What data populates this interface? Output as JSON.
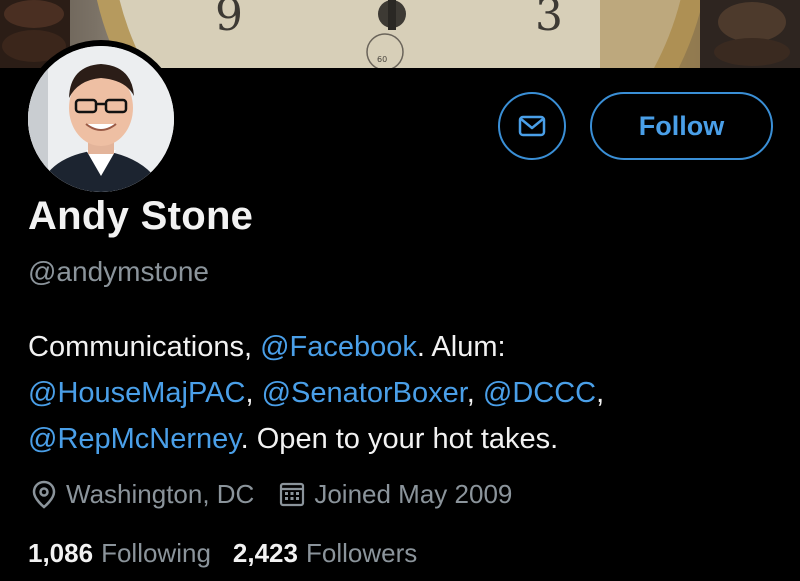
{
  "banner": {},
  "profile": {
    "name": "Andy Stone",
    "handle": "@andymstone",
    "bio": {
      "line1_text": "Communications, ",
      "line1_mention": "@Facebook",
      "line1_after": ". Alum:",
      "mention_housemajpac": "@HouseMajPAC",
      "sep1": ", ",
      "mention_senatorboxer": "@SenatorBoxer",
      "sep2": ", ",
      "mention_dccc": "@DCCC",
      "sep3": ",",
      "mention_repmcnerney": "@RepMcNerney",
      "line3_after": ". Open to your hot takes."
    },
    "location": "Washington, DC",
    "joined": "Joined May 2009",
    "following_count": "1,086",
    "following_label": "Following",
    "followers_count": "2,423",
    "followers_label": "Followers"
  },
  "actions": {
    "message_icon": "envelope-icon",
    "follow_label": "Follow"
  },
  "colors": {
    "background": "#000000",
    "accent": "#4a9fe8",
    "muted": "#8b949b",
    "text": "#f2f2f2"
  }
}
